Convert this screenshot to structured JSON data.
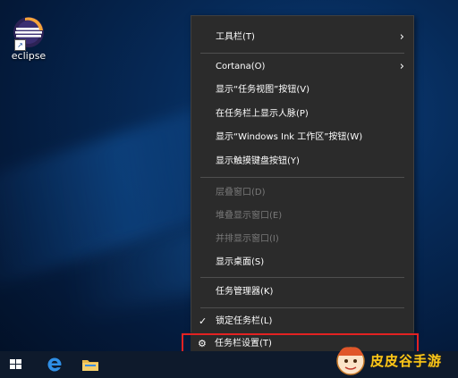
{
  "desktop": {
    "icons": [
      {
        "label": "eclipse",
        "icon": "eclipse-icon"
      }
    ]
  },
  "context_menu": {
    "items": [
      {
        "label": "工具栏(T)",
        "enabled": true,
        "has_submenu": true
      },
      {
        "label": "Cortana(O)",
        "enabled": true,
        "has_submenu": true
      },
      {
        "label": "显示“任务视图”按钮(V)",
        "enabled": true
      },
      {
        "label": "在任务栏上显示人脉(P)",
        "enabled": true
      },
      {
        "label": "显示“Windows Ink 工作区”按钮(W)",
        "enabled": true
      },
      {
        "label": "显示触摸键盘按钮(Y)",
        "enabled": true
      },
      {
        "label": "层叠窗口(D)",
        "enabled": false
      },
      {
        "label": "堆叠显示窗口(E)",
        "enabled": false
      },
      {
        "label": "并排显示窗口(I)",
        "enabled": false
      },
      {
        "label": "显示桌面(S)",
        "enabled": true
      },
      {
        "label": "任务管理器(K)",
        "enabled": true
      },
      {
        "label": "锁定任务栏(L)",
        "enabled": true,
        "checked": true,
        "icon": "checkmark-icon"
      },
      {
        "label": "任务栏设置(T)",
        "enabled": true,
        "icon": "gear-icon",
        "highlighted": true
      }
    ]
  },
  "taskbar": {
    "buttons": [
      {
        "icon": "windows-start-icon"
      },
      {
        "icon": "edge-browser-icon"
      },
      {
        "icon": "file-explorer-icon"
      }
    ]
  },
  "watermark": {
    "text": "皮皮谷手游",
    "icon": "mascot-logo-icon"
  },
  "colors": {
    "menu_background": "#2b2b2b",
    "menu_text": "#ffffff",
    "menu_disabled_text": "#7a7a7a",
    "highlight_border": "#e32222",
    "taskbar": "#0e1a2c",
    "watermark_text": "#f7c61a"
  }
}
